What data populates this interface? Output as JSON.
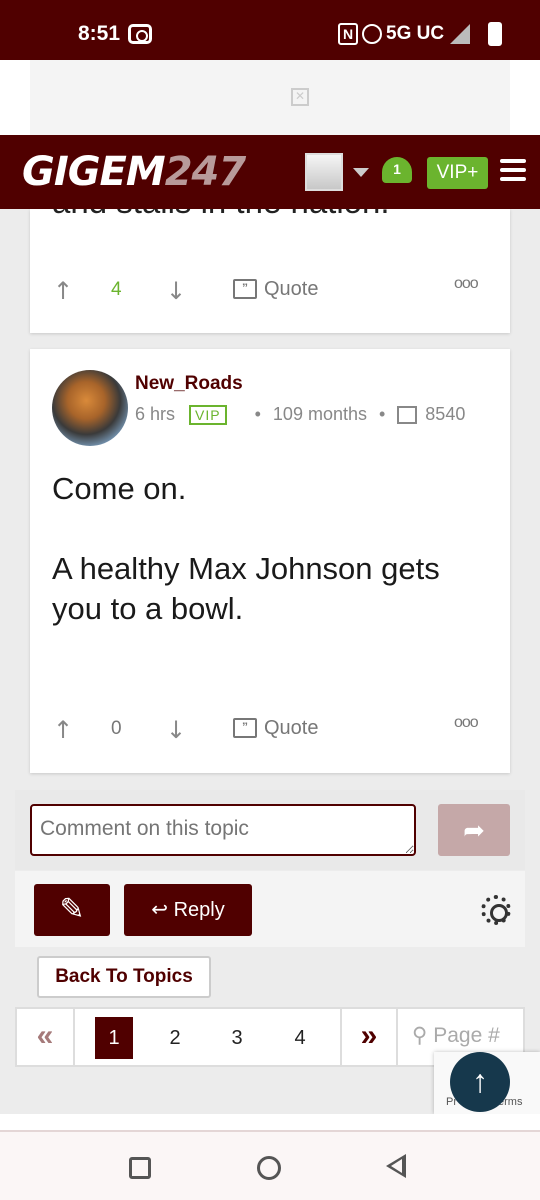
{
  "status_bar": {
    "time": "8:51",
    "network": "5G UC"
  },
  "header": {
    "logo_main": "GIGEM",
    "logo_num": "247",
    "notification_count": "1",
    "vip_label": "VIP+"
  },
  "previous_post": {
    "cut_text": "and stalls in the nation.",
    "upvotes": "4",
    "quote_label": "Quote",
    "more_label": "ooo"
  },
  "post": {
    "username": "New_Roads",
    "time_ago": "6 hrs",
    "badge": "VIP",
    "tenure": "109 months",
    "post_count": "8540",
    "paragraph1": "Come on.",
    "paragraph2": "A healthy Max Johnson gets you to a bowl.",
    "upvotes": "0",
    "quote_label": "Quote",
    "more_label": "ooo"
  },
  "comment": {
    "placeholder": "Comment on this topic"
  },
  "toolbar": {
    "reply_label": "Reply"
  },
  "back_to_topics": "Back To Topics",
  "pagination": {
    "prev": "«",
    "pages": [
      "1",
      "2",
      "3",
      "4"
    ],
    "current": "1",
    "next": "»",
    "search_placeholder": "Page #"
  },
  "recaptcha": {
    "privacy_fragment": "Pr",
    "terms_fragment": "erms"
  },
  "colors": {
    "brand_maroon": "#500000",
    "vip_green": "#6bb42e",
    "scroll_top": "#16384c"
  },
  "icons": [
    "upvote-icon",
    "downvote-icon",
    "quote-icon",
    "more-icon",
    "message-icon",
    "bell-icon",
    "menu-icon",
    "gear-icon",
    "reply-arrow-icon",
    "new-topic-icon",
    "search-icon",
    "arrow-up-icon"
  ]
}
